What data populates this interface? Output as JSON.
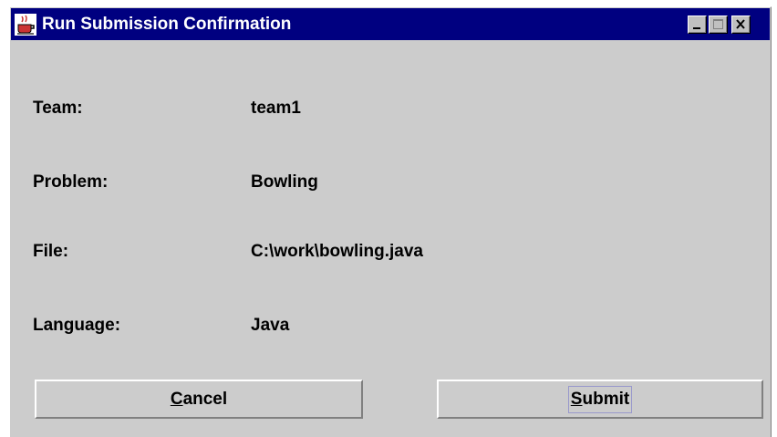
{
  "window": {
    "title": "Run Submission Confirmation",
    "controls": [
      "minimize-icon",
      "maximize-icon",
      "close-icon"
    ]
  },
  "fields": [
    {
      "label": "Team:",
      "value": "team1"
    },
    {
      "label": "Problem:",
      "value": "Bowling"
    },
    {
      "label": "File:",
      "value": "C:\\work\\bowling.java"
    },
    {
      "label": "Language:",
      "value": "Java"
    }
  ],
  "buttons": {
    "cancel": {
      "mnemonic": "C",
      "rest": "ancel"
    },
    "submit": {
      "mnemonic": "S",
      "rest": "ubmit"
    }
  },
  "icons": {
    "app": "java-cup-icon"
  }
}
